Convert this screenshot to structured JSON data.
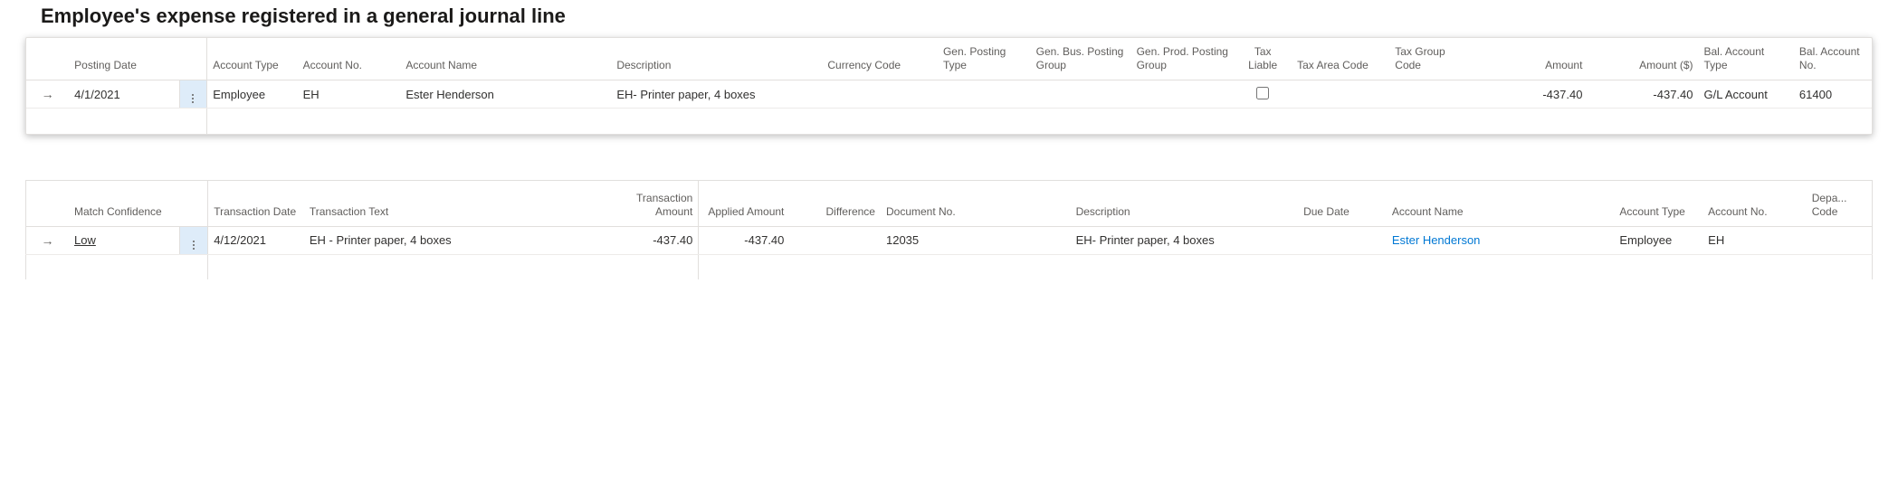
{
  "heading1": "Employee's expense registered in a general journal line",
  "journal": {
    "headers": {
      "posting_date": "Posting Date",
      "account_type": "Account Type",
      "account_no": "Account No.",
      "account_name": "Account Name",
      "description": "Description",
      "currency_code": "Currency Code",
      "gen_posting_type": "Gen. Posting Type",
      "gen_bus_posting_group": "Gen. Bus. Posting Group",
      "gen_prod_posting_group": "Gen. Prod. Posting Group",
      "tax_liable": "Tax Liable",
      "tax_area_code": "Tax Area Code",
      "tax_group_code": "Tax Group Code",
      "amount": "Amount",
      "amount_usd": "Amount ($)",
      "bal_account_type": "Bal. Account Type",
      "bal_account_no": "Bal. Account No."
    },
    "rows": [
      {
        "posting_date": "4/1/2021",
        "account_type": "Employee",
        "account_no": "EH",
        "account_name": "Ester Henderson",
        "description": "EH- Printer paper, 4 boxes",
        "currency_code": "",
        "gen_posting_type": "",
        "gen_bus_posting_group": "",
        "gen_prod_posting_group": "",
        "tax_liable": false,
        "tax_area_code": "",
        "tax_group_code": "",
        "amount": "-437.40",
        "amount_usd": "-437.40",
        "bal_account_type": "G/L Account",
        "bal_account_no": "61400"
      }
    ]
  },
  "recon": {
    "headers": {
      "match_confidence": "Match Confidence",
      "transaction_date": "Transaction Date",
      "transaction_text": "Transaction Text",
      "transaction_amount": "Transaction Amount",
      "applied_amount": "Applied Amount",
      "difference": "Difference",
      "document_no": "Document No.",
      "description": "Description",
      "due_date": "Due Date",
      "account_name": "Account Name",
      "account_type": "Account Type",
      "account_no": "Account No.",
      "dept_code": "Depa... Code"
    },
    "rows": [
      {
        "match_confidence": "Low",
        "transaction_date": "4/12/2021",
        "transaction_text": "EH - Printer paper, 4 boxes",
        "transaction_amount": "-437.40",
        "applied_amount": "-437.40",
        "difference": "",
        "document_no": "12035",
        "description": "EH- Printer paper, 4 boxes",
        "due_date": "",
        "account_name": "Ester Henderson",
        "account_type": "Employee",
        "account_no": "EH",
        "dept_code": ""
      }
    ]
  }
}
